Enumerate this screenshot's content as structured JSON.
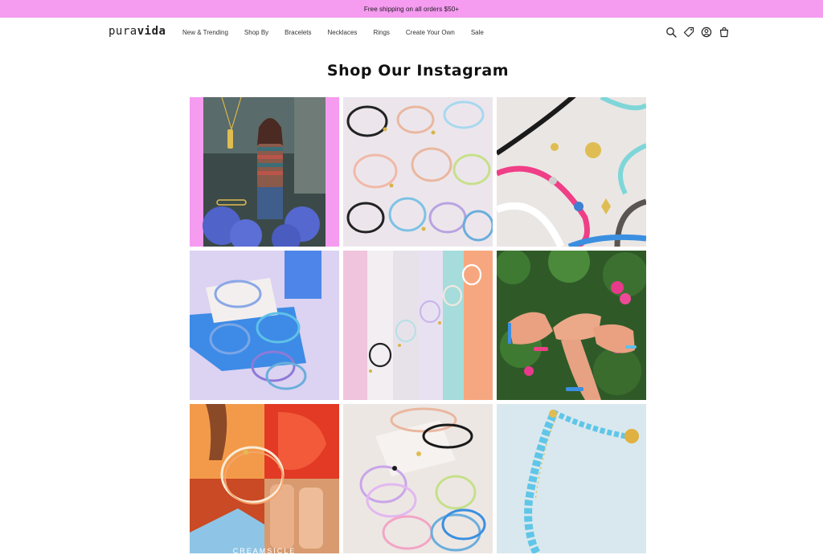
{
  "promo": {
    "text": "Free shipping on all orders $50+"
  },
  "header": {
    "logo": {
      "part1": "pura",
      "part2": "vida"
    },
    "nav": [
      "New & Trending",
      "Shop By",
      "Bracelets",
      "Necklaces",
      "Rings",
      "Create Your Own",
      "Sale"
    ],
    "icons": [
      "search-icon",
      "tag-icon",
      "account-icon",
      "cart-icon"
    ]
  },
  "main": {
    "title": "Shop Our Instagram",
    "posts": [
      {
        "subject": "model-wearing-necklace"
      },
      {
        "subject": "pastel-string-bracelets"
      },
      {
        "subject": "charm-bracelets"
      },
      {
        "subject": "bracelet-stack-on-box"
      },
      {
        "subject": "bracelets-on-pastel-stripes"
      },
      {
        "subject": "hands-with-bracelets-in-flowers"
      },
      {
        "subject": "creamsicle-bracelet",
        "caption": "CREAMSICLE"
      },
      {
        "subject": "pastel-bracelet-pile"
      },
      {
        "subject": "blue-braided-bracelet"
      }
    ]
  },
  "colors": {
    "promo_bg": "#f59bf0",
    "accent_pink": "#f59bf0",
    "text": "#111111"
  }
}
